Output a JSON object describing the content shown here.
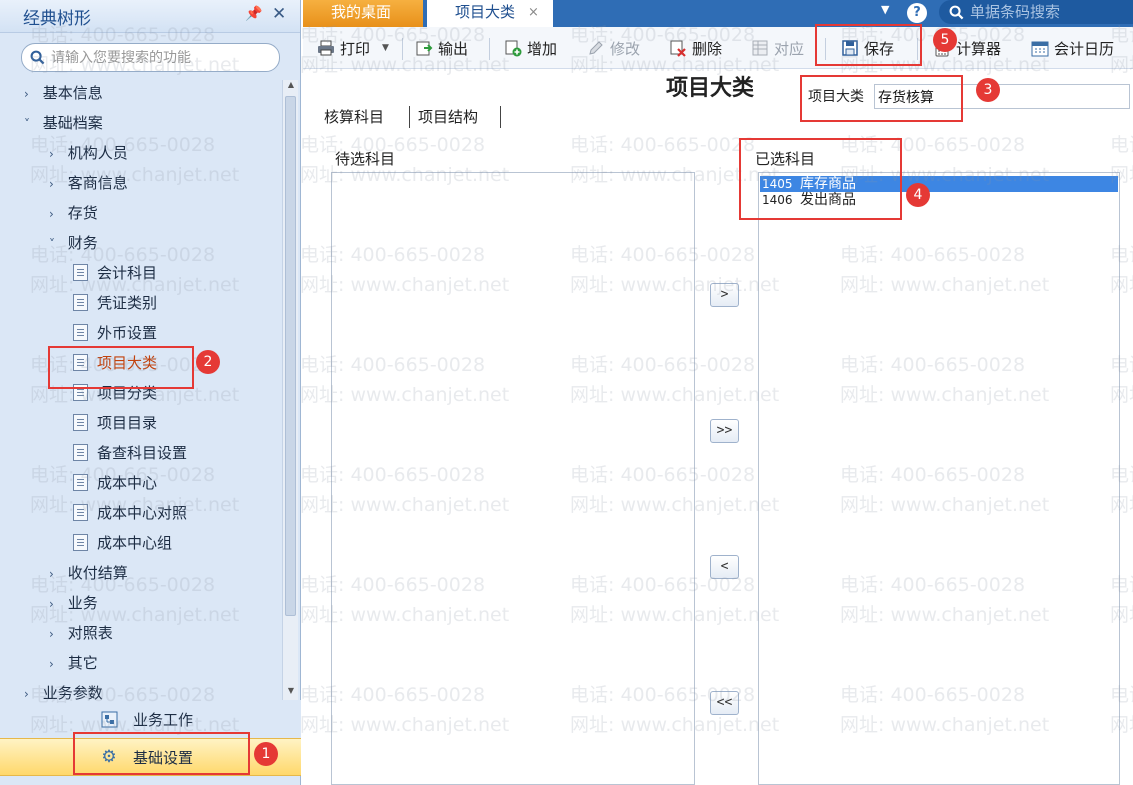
{
  "sidebar": {
    "title": "经典树形",
    "search_placeholder": "请输入您要搜索的功能",
    "tree": [
      {
        "label": "基本信息",
        "arrow": "›"
      },
      {
        "label": "基础档案",
        "arrow": "˅"
      },
      {
        "label": "机构人员",
        "arrow": "›"
      },
      {
        "label": "客商信息",
        "arrow": "›"
      },
      {
        "label": "存货",
        "arrow": "›"
      },
      {
        "label": "财务",
        "arrow": "˅"
      },
      {
        "label": "会计科目"
      },
      {
        "label": "凭证类别"
      },
      {
        "label": "外币设置"
      },
      {
        "label": "项目大类"
      },
      {
        "label": "项目分类"
      },
      {
        "label": "项目目录"
      },
      {
        "label": "备查科目设置"
      },
      {
        "label": "成本中心"
      },
      {
        "label": "成本中心对照"
      },
      {
        "label": "成本中心组"
      },
      {
        "label": "收付结算",
        "arrow": "›"
      },
      {
        "label": "业务",
        "arrow": "›"
      },
      {
        "label": "对照表",
        "arrow": "›"
      },
      {
        "label": "其它",
        "arrow": "›"
      },
      {
        "label": "业务参数",
        "arrow": "›"
      }
    ],
    "modules": {
      "yewu": "业务工作",
      "jichu": "基础设置"
    }
  },
  "topbar": {
    "tabs": [
      "我的桌面",
      "项目大类"
    ],
    "tab_close": "×",
    "help": "?",
    "barcode_placeholder": "单据条码搜索"
  },
  "toolbar": {
    "print": "打印",
    "export": "输出",
    "add": "增加",
    "edit": "修改",
    "delete": "删除",
    "map": "对应",
    "save": "保存",
    "calculator": "计算器",
    "calendar": "会计日历"
  },
  "form": {
    "page_title": "项目大类",
    "field_label": "项目大类",
    "field_value": "存货核算",
    "subtabs": [
      "核算科目",
      "项目结构"
    ],
    "available_label": "待选科目",
    "selected_label": "已选科目",
    "selected_items": [
      {
        "code": "1405",
        "name": "库存商品",
        "selected": true
      },
      {
        "code": "1406",
        "name": "发出商品",
        "selected": false
      }
    ],
    "buttons": {
      "add": ">",
      "add_all": ">>",
      "remove": "<",
      "remove_all": "<<"
    }
  },
  "watermark": {
    "phone": "电话: 400-665-0028",
    "site": "网址: www.chanjet.net"
  },
  "annotations": [
    "1",
    "2",
    "3",
    "4",
    "5"
  ],
  "colors": {
    "accent": "#2f6db5",
    "tab_active_orange": "#e8901a",
    "highlight_red": "#e53935",
    "selection_blue": "#3d86e3"
  }
}
